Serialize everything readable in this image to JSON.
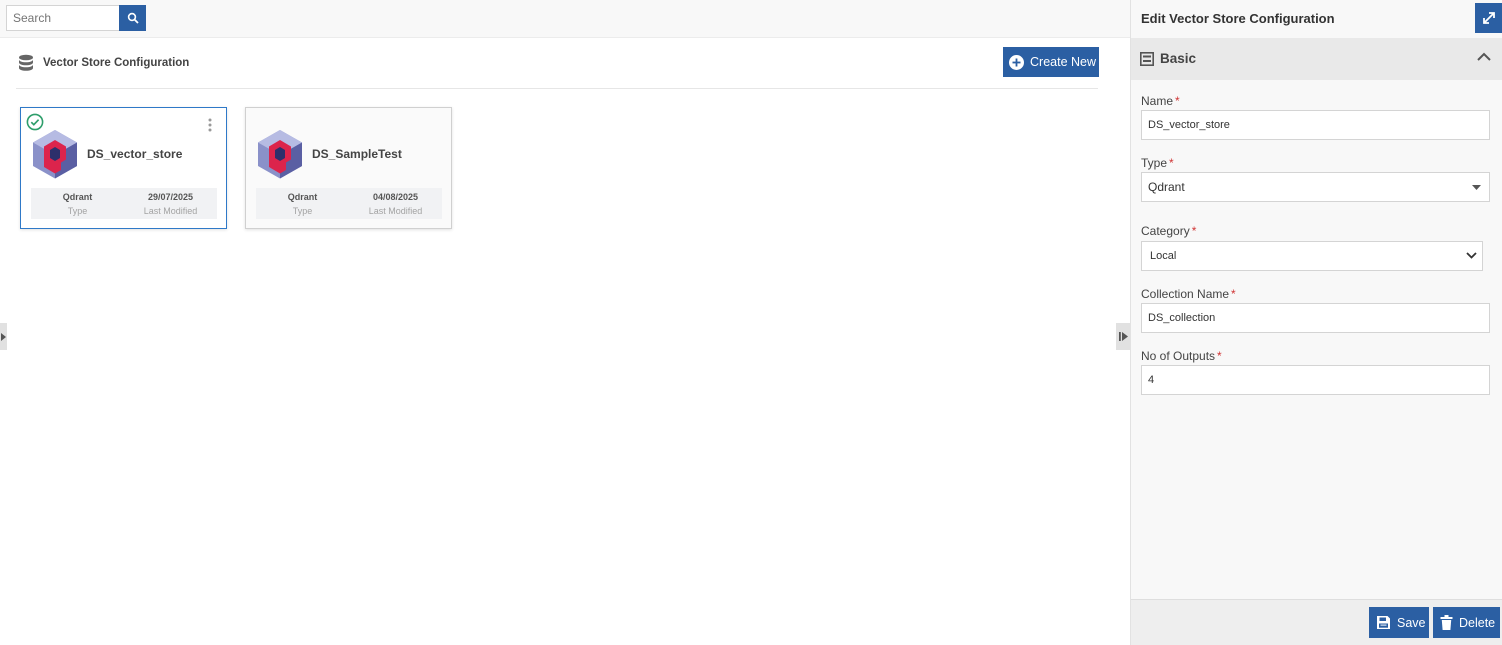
{
  "search": {
    "placeholder": "Search"
  },
  "section": {
    "title": "Vector Store Configuration",
    "create_label": "Create New"
  },
  "cards": [
    {
      "name": "DS_vector_store",
      "type": "Qdrant",
      "type_label": "Type",
      "modified": "29/07/2025",
      "modified_label": "Last Modified",
      "selected": true
    },
    {
      "name": "DS_SampleTest",
      "type": "Qdrant",
      "type_label": "Type",
      "modified": "04/08/2025",
      "modified_label": "Last Modified",
      "selected": false
    }
  ],
  "panel": {
    "title": "Edit Vector Store Configuration",
    "section_title": "Basic",
    "fields": {
      "name": {
        "label": "Name",
        "value": "DS_vector_store"
      },
      "type": {
        "label": "Type",
        "value": "Qdrant"
      },
      "category": {
        "label": "Category",
        "value": "Local"
      },
      "collection": {
        "label": "Collection Name",
        "value": "DS_collection"
      },
      "outputs": {
        "label": "No of Outputs",
        "value": "4"
      }
    },
    "required_mark": "*",
    "save_label": "Save",
    "delete_label": "Delete"
  },
  "colors": {
    "accent": "#2b5fa3",
    "selected_border": "#2f79c8",
    "success": "#2e9e6b",
    "required": "#d03535"
  },
  "icons": [
    "search-icon",
    "database-icon",
    "plus-circle-icon",
    "check-circle-icon",
    "kebab-icon",
    "qdrant-logo",
    "expand-icon",
    "form-icon",
    "chevron-up-icon",
    "caret-down-icon",
    "chevron-down-icon",
    "save-icon",
    "trash-icon"
  ]
}
